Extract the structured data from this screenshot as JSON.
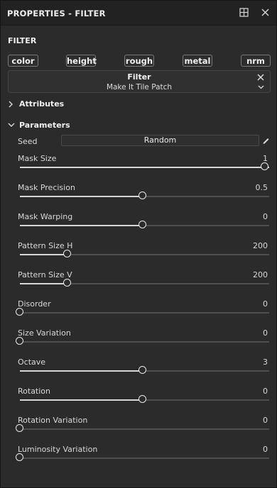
{
  "panel": {
    "title": "PROPERTIES - FILTER",
    "section": "FILTER"
  },
  "channels": [
    "color",
    "height",
    "rough",
    "metal",
    "nrm"
  ],
  "filter": {
    "label": "Filter",
    "value": "Make It Tile Patch"
  },
  "groups": {
    "attributes": "Attributes",
    "parameters": "Parameters"
  },
  "seed": {
    "label": "Seed",
    "button": "Random"
  },
  "params": [
    {
      "name": "Mask Size",
      "value": "1",
      "fraction": 1.0
    },
    {
      "name": "Mask Precision",
      "value": "0.5",
      "fraction": 0.5
    },
    {
      "name": "Mask Warping",
      "value": "0",
      "fraction": 0.5
    },
    {
      "name": "Pattern Size H",
      "value": "200",
      "fraction": 0.195
    },
    {
      "name": "Pattern Size V",
      "value": "200",
      "fraction": 0.195
    },
    {
      "name": "Disorder",
      "value": "0",
      "fraction": 0.0
    },
    {
      "name": "Size Variation",
      "value": "0",
      "fraction": 0.0
    },
    {
      "name": "Octave",
      "value": "3",
      "fraction": 0.5
    },
    {
      "name": "Rotation",
      "value": "0",
      "fraction": 0.5
    },
    {
      "name": "Rotation Variation",
      "value": "0",
      "fraction": 0.0
    },
    {
      "name": "Luminosity Variation",
      "value": "0",
      "fraction": 0.0
    }
  ],
  "icons": {
    "dock": "dock-icon",
    "close": "close-icon",
    "expand": "chevron-right-icon",
    "collapse": "chevron-down-icon",
    "edit": "pencil-icon"
  }
}
